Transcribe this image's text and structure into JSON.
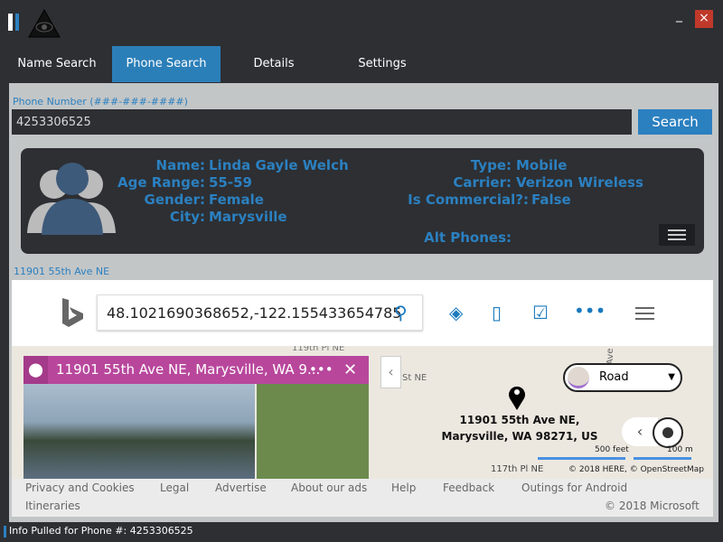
{
  "window": {
    "close_icon": "×"
  },
  "tabs": [
    {
      "label": "Name Search"
    },
    {
      "label": "Phone Search",
      "active": true
    },
    {
      "label": "Details"
    },
    {
      "label": "Settings"
    }
  ],
  "phone": {
    "label": "Phone Number (###-###-####)",
    "value": "4253306525",
    "search_label": "Search"
  },
  "result": {
    "name_label": "Name:",
    "name": "Linda Gayle Welch",
    "age_label": "Age Range:",
    "age": "55-59",
    "gender_label": "Gender:",
    "gender": "Female",
    "city_label": "City:",
    "city": "Marysville",
    "type_label": "Type:",
    "type": "Mobile",
    "carrier_label": "Carrier:",
    "carrier": "Verizon Wireless",
    "commercial_label": "Is Commercial?:",
    "commercial": "False",
    "alt_label": "Alt Phones:"
  },
  "address_label": "11901 55th Ave NE",
  "map": {
    "search_value": "48.1021690368652,-122.155433654785",
    "card_title": "11901 55th Ave NE, Marysville, WA 9...",
    "pin_label_1": "11901 55th Ave NE,",
    "pin_label_2": "Marysville, WA 98271, US",
    "map_type": "Road",
    "scale_feet": "500 feet",
    "scale_m": "100 m",
    "copyright": "© 2018 HERE, © OpenStreetMap",
    "streets": [
      "119th Pl NE",
      "St NE",
      "58th Ave",
      "117th Pl NE"
    ]
  },
  "footer": {
    "links": [
      "Privacy and Cookies",
      "Legal",
      "Advertise",
      "About our ads",
      "Help",
      "Feedback",
      "Outings for Android",
      "Itineraries"
    ],
    "copyright": "© 2018 Microsoft"
  },
  "status": "Info Pulled for Phone #: 4253306525",
  "colors": {
    "accent": "#2b80c0",
    "card_header": "#b8479c",
    "background": "#2d2f33"
  }
}
